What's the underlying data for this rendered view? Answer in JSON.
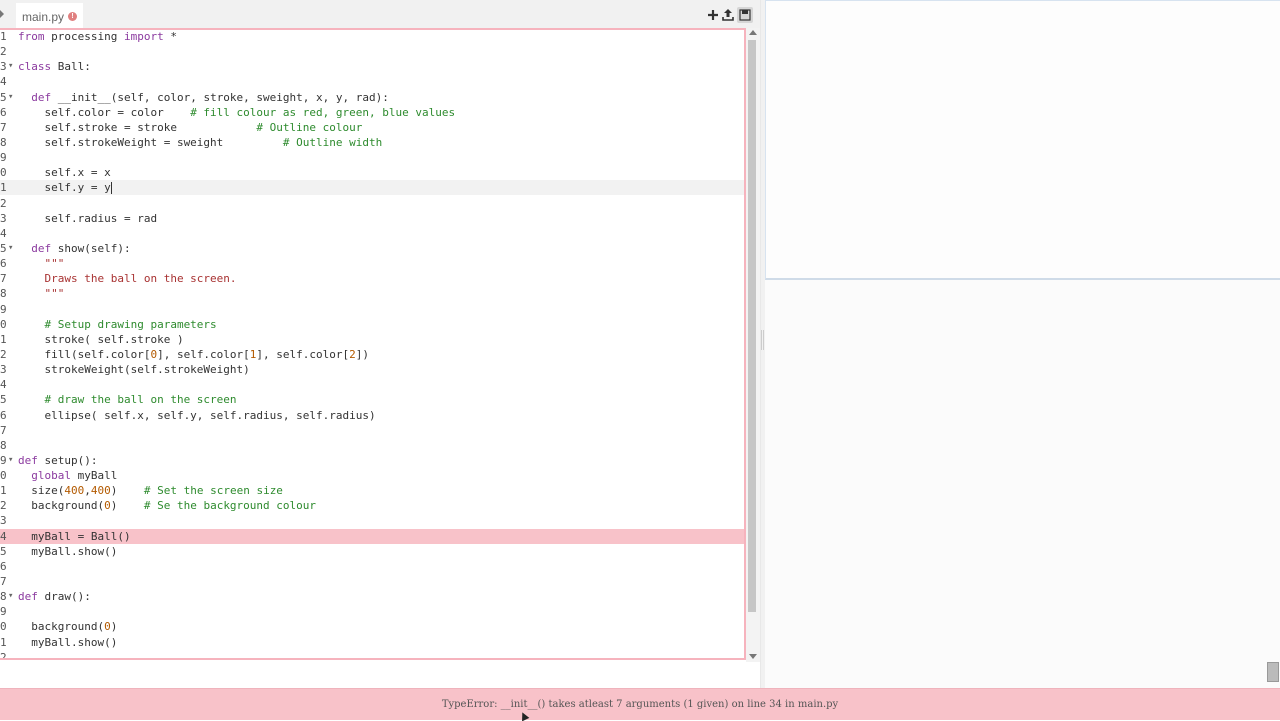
{
  "editor": {
    "tab_label": "main.py",
    "tab_error_badge": "!",
    "code_lines": [
      {
        "n": "1",
        "fold": "",
        "segments": [
          {
            "t": "from",
            "c": "kw"
          },
          {
            "t": " processing ",
            "c": ""
          },
          {
            "t": "import",
            "c": "kw"
          },
          {
            "t": " *",
            "c": ""
          }
        ]
      },
      {
        "n": "2",
        "fold": "",
        "segments": []
      },
      {
        "n": "3",
        "fold": "▾",
        "segments": [
          {
            "t": "class",
            "c": "kw"
          },
          {
            "t": " Ball:",
            "c": ""
          }
        ]
      },
      {
        "n": "4",
        "fold": "",
        "segments": []
      },
      {
        "n": "5",
        "fold": "▾",
        "segments": [
          {
            "t": "  def",
            "c": "kw"
          },
          {
            "t": " __init__(self, color, stroke, sweight, x, y, rad):",
            "c": ""
          }
        ]
      },
      {
        "n": "6",
        "fold": "",
        "segments": [
          {
            "t": "    self.color = color    ",
            "c": ""
          },
          {
            "t": "# fill colour as red, green, blue values",
            "c": "cm"
          }
        ]
      },
      {
        "n": "7",
        "fold": "",
        "segments": [
          {
            "t": "    self.stroke = stroke            ",
            "c": ""
          },
          {
            "t": "# Outline colour",
            "c": "cm"
          }
        ]
      },
      {
        "n": "8",
        "fold": "",
        "segments": [
          {
            "t": "    self.strokeWeight = sweight         ",
            "c": ""
          },
          {
            "t": "# Outline width",
            "c": "cm"
          }
        ]
      },
      {
        "n": "9",
        "fold": "",
        "segments": []
      },
      {
        "n": "0",
        "fold": "",
        "segments": [
          {
            "t": "    self.x = x",
            "c": ""
          }
        ]
      },
      {
        "n": "1",
        "fold": "",
        "segments": [
          {
            "t": "    self.y = y",
            "c": ""
          }
        ],
        "cursor": true
      },
      {
        "n": "2",
        "fold": "",
        "segments": []
      },
      {
        "n": "3",
        "fold": "",
        "segments": [
          {
            "t": "    self.radius = rad",
            "c": ""
          }
        ]
      },
      {
        "n": "4",
        "fold": "",
        "segments": []
      },
      {
        "n": "5",
        "fold": "▾",
        "segments": [
          {
            "t": "  def",
            "c": "kw"
          },
          {
            "t": " show(self):",
            "c": ""
          }
        ]
      },
      {
        "n": "6",
        "fold": "",
        "segments": [
          {
            "t": "    \"\"\"",
            "c": "st"
          }
        ]
      },
      {
        "n": "7",
        "fold": "",
        "segments": [
          {
            "t": "    Draws the ball on the screen.",
            "c": "st"
          }
        ]
      },
      {
        "n": "8",
        "fold": "",
        "segments": [
          {
            "t": "    \"\"\"",
            "c": "st"
          }
        ]
      },
      {
        "n": "9",
        "fold": "",
        "segments": []
      },
      {
        "n": "0",
        "fold": "",
        "segments": [
          {
            "t": "    # Setup drawing parameters",
            "c": "cm"
          }
        ]
      },
      {
        "n": "1",
        "fold": "",
        "segments": [
          {
            "t": "    stroke( self.stroke )",
            "c": ""
          }
        ]
      },
      {
        "n": "2",
        "fold": "",
        "segments": [
          {
            "t": "    fill(self.color[",
            "c": ""
          },
          {
            "t": "0",
            "c": "num"
          },
          {
            "t": "], self.color[",
            "c": ""
          },
          {
            "t": "1",
            "c": "num"
          },
          {
            "t": "], self.color[",
            "c": ""
          },
          {
            "t": "2",
            "c": "num"
          },
          {
            "t": "])",
            "c": ""
          }
        ]
      },
      {
        "n": "3",
        "fold": "",
        "segments": [
          {
            "t": "    strokeWeight(self.strokeWeight)",
            "c": ""
          }
        ]
      },
      {
        "n": "4",
        "fold": "",
        "segments": []
      },
      {
        "n": "5",
        "fold": "",
        "segments": [
          {
            "t": "    # draw the ball on the screen",
            "c": "cm"
          }
        ]
      },
      {
        "n": "6",
        "fold": "",
        "segments": [
          {
            "t": "    ellipse( self.x, self.y, self.radius, self.radius)",
            "c": ""
          }
        ]
      },
      {
        "n": "7",
        "fold": "",
        "segments": []
      },
      {
        "n": "8",
        "fold": "",
        "segments": []
      },
      {
        "n": "9",
        "fold": "▾",
        "segments": [
          {
            "t": "def",
            "c": "kw"
          },
          {
            "t": " setup():",
            "c": ""
          }
        ]
      },
      {
        "n": "0",
        "fold": "",
        "segments": [
          {
            "t": "  global",
            "c": "kw"
          },
          {
            "t": " myBall",
            "c": ""
          }
        ]
      },
      {
        "n": "1",
        "fold": "",
        "segments": [
          {
            "t": "  size(",
            "c": ""
          },
          {
            "t": "400",
            "c": "num"
          },
          {
            "t": ",",
            "c": ""
          },
          {
            "t": "400",
            "c": "num"
          },
          {
            "t": ")    ",
            "c": ""
          },
          {
            "t": "# Set the screen size",
            "c": "cm"
          }
        ]
      },
      {
        "n": "2",
        "fold": "",
        "segments": [
          {
            "t": "  background(",
            "c": ""
          },
          {
            "t": "0",
            "c": "num"
          },
          {
            "t": ")    ",
            "c": ""
          },
          {
            "t": "# Se the background colour",
            "c": "cm"
          }
        ]
      },
      {
        "n": "3",
        "fold": "",
        "segments": []
      },
      {
        "n": "4",
        "fold": "",
        "segments": [
          {
            "t": "  myBall = Ball()",
            "c": ""
          }
        ],
        "error": true
      },
      {
        "n": "5",
        "fold": "",
        "segments": [
          {
            "t": "  myBall.show()",
            "c": ""
          }
        ]
      },
      {
        "n": "6",
        "fold": "",
        "segments": []
      },
      {
        "n": "7",
        "fold": "",
        "segments": []
      },
      {
        "n": "8",
        "fold": "▾",
        "segments": [
          {
            "t": "def",
            "c": "kw"
          },
          {
            "t": " draw():",
            "c": ""
          }
        ]
      },
      {
        "n": "9",
        "fold": "",
        "segments": []
      },
      {
        "n": "0",
        "fold": "",
        "segments": [
          {
            "t": "  background(",
            "c": ""
          },
          {
            "t": "0",
            "c": "num"
          },
          {
            "t": ")",
            "c": ""
          }
        ]
      },
      {
        "n": "1",
        "fold": "",
        "segments": [
          {
            "t": "  myBall.show()",
            "c": ""
          }
        ]
      },
      {
        "n": "2",
        "fold": "",
        "segments": []
      }
    ]
  },
  "toolbar": {
    "add_icon": "plus-icon",
    "upload_icon": "upload-icon",
    "save_icon": "save-icon"
  },
  "status": {
    "error_message": "TypeError: __init__() takes atleast 7 arguments (1 given) on line 34 in main.py"
  },
  "colors": {
    "error_bg": "#f8c2c9",
    "keyword": "#8b3a9f",
    "comment": "#2e8b2e",
    "string": "#a83232",
    "number": "#b35a00"
  }
}
